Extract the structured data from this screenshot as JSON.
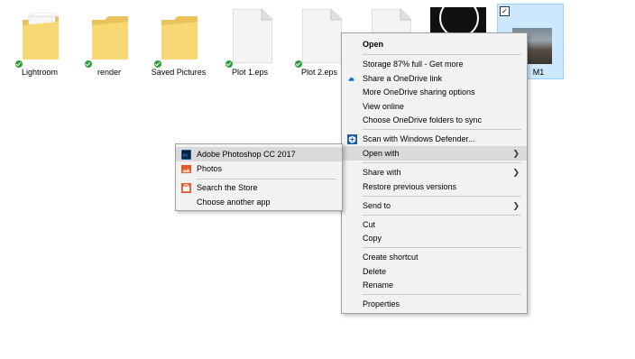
{
  "files": [
    {
      "name": "Lightroom",
      "type": "folder",
      "synced": true
    },
    {
      "name": "render",
      "type": "folder",
      "synced": true
    },
    {
      "name": "Saved Pictures",
      "type": "folder",
      "synced": true
    },
    {
      "name": "Plot 1.eps",
      "type": "document",
      "synced": true
    },
    {
      "name": "Plot 2.eps",
      "type": "document",
      "synced": true
    },
    {
      "name": "",
      "type": "document",
      "synced": false
    },
    {
      "name": "",
      "type": "image-dark",
      "synced": false
    },
    {
      "name": "M1",
      "type": "image-photo",
      "synced": false,
      "selected": true,
      "checked": "✓"
    }
  ],
  "context_menu": {
    "items": [
      {
        "label": "Open",
        "bold": true
      },
      {
        "separator": true
      },
      {
        "label": "Storage 87% full - Get more"
      },
      {
        "label": "Share a OneDrive link",
        "icon": "onedrive-cloud-icon"
      },
      {
        "label": "More OneDrive sharing options"
      },
      {
        "label": "View online"
      },
      {
        "label": "Choose OneDrive folders to sync"
      },
      {
        "separator": true
      },
      {
        "label": "Scan with Windows Defender...",
        "icon": "windows-defender-icon"
      },
      {
        "label": "Open with",
        "submenu": true,
        "highlighted": true
      },
      {
        "separator": true
      },
      {
        "label": "Share with",
        "submenu": true
      },
      {
        "label": "Restore previous versions"
      },
      {
        "separator": true
      },
      {
        "label": "Send to",
        "submenu": true
      },
      {
        "separator": true
      },
      {
        "label": "Cut"
      },
      {
        "label": "Copy"
      },
      {
        "separator": true
      },
      {
        "label": "Create shortcut"
      },
      {
        "label": "Delete"
      },
      {
        "label": "Rename"
      },
      {
        "separator": true
      },
      {
        "label": "Properties"
      }
    ]
  },
  "submenu": {
    "items": [
      {
        "label": "Adobe Photoshop CC 2017",
        "icon": "photoshop-icon",
        "highlighted": true
      },
      {
        "label": "Photos",
        "icon": "photos-icon"
      },
      {
        "separator": true
      },
      {
        "label": "Search the Store",
        "icon": "store-icon"
      },
      {
        "label": "Choose another app"
      }
    ]
  },
  "colors": {
    "menu_bg": "#f2f2f2",
    "highlight": "#d9d9d9",
    "selection": "#cce8ff",
    "folder": "#f8d775",
    "sync_green": "#2e9e3a",
    "onedrive_blue": "#0f78d4",
    "photoshop_blue": "#001e36"
  }
}
